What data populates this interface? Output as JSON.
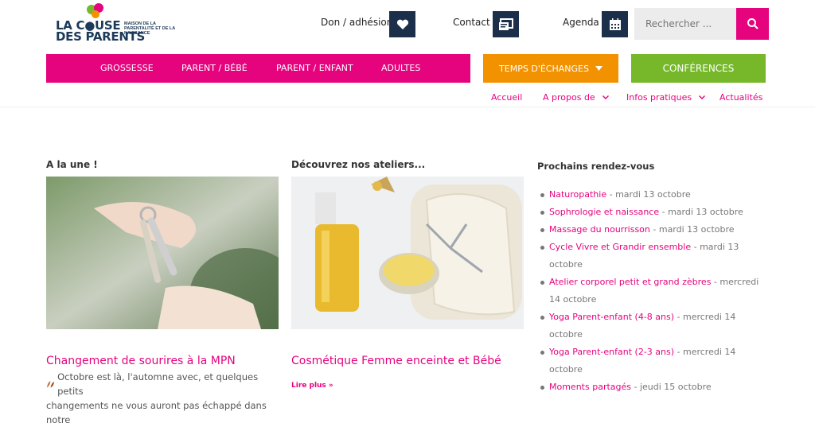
{
  "header": {
    "logo": {
      "line1": "LA C●USE",
      "line2": "DES PARENTS",
      "subtitle": "MAISON DE LA PARENTALITÉ ET DE LA NAISSANCE"
    },
    "don_label": "Don / adhésion",
    "contact_label": "Contact",
    "agenda_label": "Agenda",
    "search_placeholder": "Rechercher ..."
  },
  "nav": {
    "main": [
      "GROSSESSE",
      "PARENT / BÉBÉ",
      "PARENT / ENFANT",
      "ADULTES"
    ],
    "temps": "TEMPS D'ÉCHANGES",
    "conferences": "CONFÉRENCES",
    "sub": [
      "Accueil",
      "A propos de",
      "Infos pratiques",
      "Actualités"
    ]
  },
  "une": {
    "heading": "A la une !",
    "post_title": "Changement de sourires à la MPN",
    "excerpt_lines": [
      "Octobre est là, l'automne avec, et quelques petits",
      "changements ne vous auront pas échappé dans notre"
    ]
  },
  "ateliers": {
    "heading": "Découvrez nos ateliers...",
    "post_title": "Cosmétique Femme enceinte et Bébé",
    "readmore": "Lire plus »"
  },
  "rdv": {
    "heading": "Prochains rendez-vous",
    "events": [
      {
        "name": "Naturopathie",
        "date": " - mardi 13 octobre"
      },
      {
        "name": "Sophrologie et naissance",
        "date": " - mardi 13 octobre"
      },
      {
        "name": "Massage du nourrisson",
        "date": " - mardi 13 octobre"
      },
      {
        "name": "Cycle Vivre et Grandir ensemble",
        "date": " - mardi 13 octobre"
      },
      {
        "name": "Atelier corporel petit et grand zèbres",
        "date": " - mercredi 14 octobre"
      },
      {
        "name": "Yoga Parent-enfant (4-8 ans)",
        "date": " - mercredi 14 octobre"
      },
      {
        "name": "Yoga Parent-enfant (2-3 ans)",
        "date": " - mercredi 14 octobre"
      },
      {
        "name": "Moments partagés",
        "date": " - jeudi 15 octobre"
      }
    ]
  },
  "colors": {
    "pink": "#e5037e",
    "orange": "#f39200",
    "green": "#76b82a",
    "navy": "#1c2f4a"
  }
}
